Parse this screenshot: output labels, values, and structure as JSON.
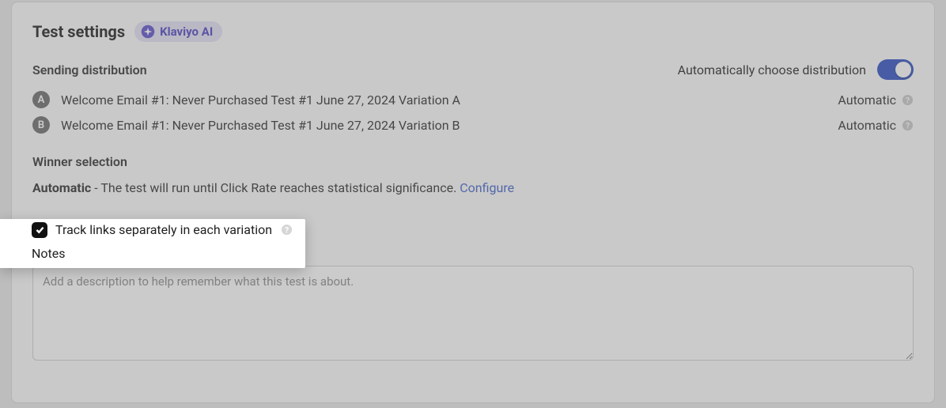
{
  "header": {
    "title": "Test settings",
    "ai_badge": "Klaviyo AI"
  },
  "distribution": {
    "section_label": "Sending distribution",
    "auto_label": "Automatically choose distribution",
    "toggle_on": true,
    "variations": [
      {
        "letter": "A",
        "name": "Welcome Email #1: Never Purchased Test #1 June 27, 2024 Variation A",
        "mode": "Automatic"
      },
      {
        "letter": "B",
        "name": "Welcome Email #1: Never Purchased Test #1 June 27, 2024 Variation B",
        "mode": "Automatic"
      }
    ]
  },
  "winner": {
    "section_label": "Winner selection",
    "mode": "Automatic",
    "description": " - The test will run until Click Rate reaches statistical significance. ",
    "configure": "Configure"
  },
  "track_links": {
    "checked": true,
    "label": "Track links separately in each variation"
  },
  "notes": {
    "label": "Notes",
    "value": "",
    "placeholder": "Add a description to help remember what this test is about."
  }
}
